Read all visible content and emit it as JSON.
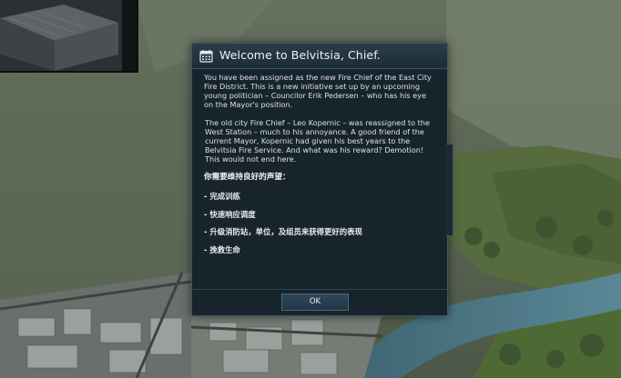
{
  "dialog": {
    "icon": "calendar-icon",
    "title": "Welcome to Belvitsia, Chief.",
    "paragraphs": [
      "You have been assigned as the new Fire Chief of the East City Fire District. This is a new initiative set up by an upcoming young politician – Councilor Erik Pedersen – who has his eye on the Mayor's position.",
      "The old city Fire Chief – Leo Kopernic – was reassigned to the West Station – much to his annoyance. A good friend of the current Mayor, Kopernic had given his best years to the Belvitsia Fire Service. And what was his reward? Demotion! This would not end here."
    ],
    "objectives_heading": "你需要维持良好的声望：",
    "objectives": [
      "- 完成训练",
      "- 快速响应调度",
      "- 升级消防站，单位，及组员来获得更好的表现",
      "- 挽救生命"
    ],
    "ok_label": "OK"
  },
  "colors": {
    "dialog_bg": "#16222a",
    "dialog_border": "#3f5664",
    "text": "#d9e1e6"
  }
}
